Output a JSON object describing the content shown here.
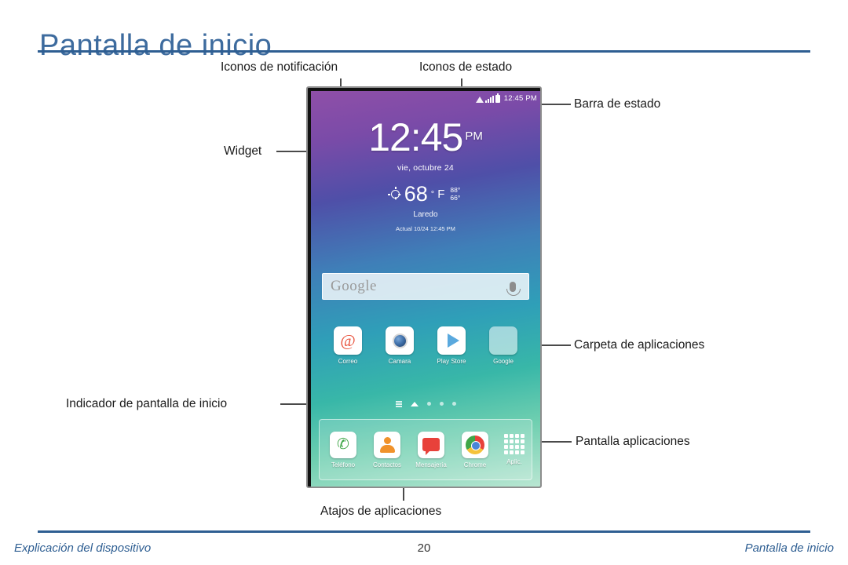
{
  "header": {
    "title": "Pantalla de inicio"
  },
  "footer": {
    "left": "Explicación del dispositivo",
    "page_number": "20",
    "right": "Pantalla de inicio"
  },
  "callouts": {
    "notification_icons": "Iconos de notificación",
    "status_icons": "Iconos de estado",
    "status_bar": "Barra de estado",
    "widget": "Widget",
    "app_folder": "Carpeta de aplicaciones",
    "home_screen_indicator": "Indicador de pantalla de inicio",
    "apps_screen": "Pantalla aplicaciones",
    "app_shortcuts": "Atajos de aplicaciones"
  },
  "phone": {
    "status_bar": {
      "time": "12:45 PM",
      "icons": [
        "wifi-icon",
        "signal-icon",
        "battery-icon"
      ]
    },
    "clock_widget": {
      "time": "12:45",
      "ampm": "PM",
      "date": "vie, octubre 24"
    },
    "weather_widget": {
      "icon": "sun-icon",
      "temperature": "68",
      "degree": "°",
      "unit": "F",
      "high": "88°",
      "low": "66°",
      "city": "Laredo",
      "updated": "Actual  10/24 12:45 PM"
    },
    "search": {
      "logo": "Google",
      "mic_icon": "microphone-icon"
    },
    "apps": [
      {
        "label": "Correo",
        "icon": "email-icon"
      },
      {
        "label": "Camara",
        "icon": "camera-icon"
      },
      {
        "label": "Play Store",
        "icon": "play-store-icon"
      },
      {
        "label": "Google",
        "icon": "google-folder-icon"
      }
    ],
    "page_indicator": {
      "pages": 5,
      "current": 1
    },
    "dock": [
      {
        "label": "Teléfono",
        "icon": "phone-icon"
      },
      {
        "label": "Contactos",
        "icon": "contacts-icon"
      },
      {
        "label": "Mensajería",
        "icon": "messaging-icon"
      },
      {
        "label": "Chrome",
        "icon": "chrome-icon"
      }
    ],
    "apps_button": {
      "label": "Aplic.",
      "icon": "apps-grid-icon"
    }
  },
  "colors": {
    "accent": "#2e5e92",
    "title": "#3d6b9e",
    "leader": "#4a4a4a"
  }
}
